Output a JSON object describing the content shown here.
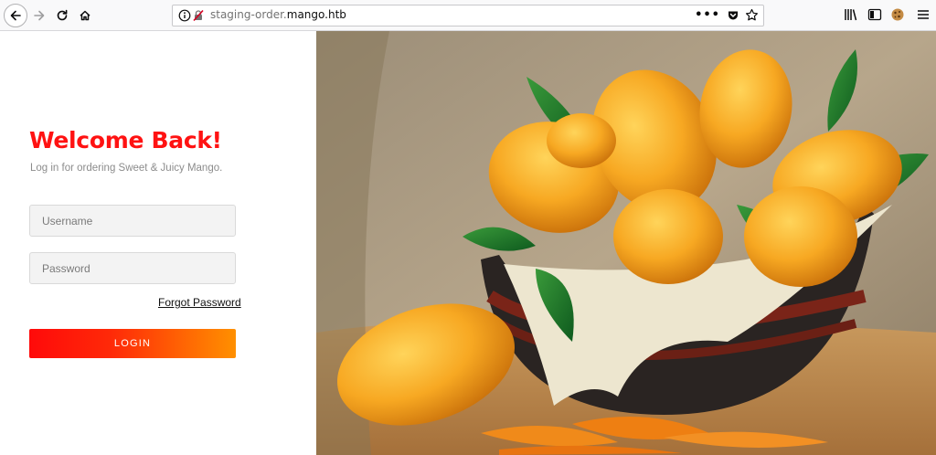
{
  "browser": {
    "url_prefix": "staging-order.",
    "url_domain": "mango.htb",
    "page_actions": "•••",
    "icons": [
      "back-arrow-icon",
      "forward-arrow-icon",
      "reload-icon",
      "home-icon",
      "info-icon",
      "insecure-lock-icon",
      "pocket-icon",
      "star-icon",
      "library-icon",
      "sidebar-icon",
      "cookie-icon",
      "hamburger-menu-icon"
    ]
  },
  "login": {
    "title": "Welcome Back!",
    "subtitle": "Log in for ordering Sweet & Juicy Mango.",
    "username_placeholder": "Username",
    "password_placeholder": "Password",
    "forgot_label": "Forgot Password",
    "login_label": "LOGIN"
  },
  "colors": {
    "accent": "#ff1212",
    "button_gradient_start": "#ff0a0a",
    "button_gradient_end": "#ff9000"
  }
}
